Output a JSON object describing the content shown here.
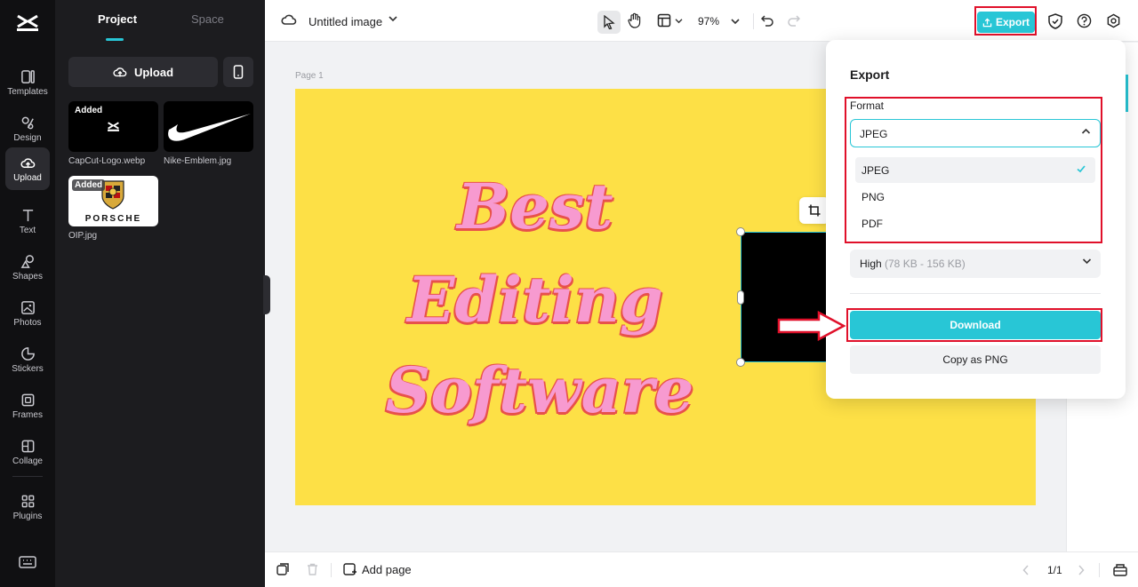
{
  "sidebar": {
    "items": [
      {
        "label": "Templates",
        "icon": "templates-icon"
      },
      {
        "label": "Design",
        "icon": "design-icon"
      },
      {
        "label": "Upload",
        "icon": "upload-cloud-icon",
        "active": true
      },
      {
        "label": "Text",
        "icon": "text-icon"
      },
      {
        "label": "Shapes",
        "icon": "shapes-icon"
      },
      {
        "label": "Photos",
        "icon": "photos-icon"
      },
      {
        "label": "Stickers",
        "icon": "stickers-icon"
      },
      {
        "label": "Frames",
        "icon": "frames-icon"
      },
      {
        "label": "Collage",
        "icon": "collage-icon"
      },
      {
        "label": "Plugins",
        "icon": "plugins-icon"
      }
    ]
  },
  "panel": {
    "tabs": [
      {
        "label": "Project"
      },
      {
        "label": "Space"
      }
    ],
    "upload_label": "Upload",
    "assets": [
      {
        "name": "CapCut-Logo.webp",
        "badge": "Added"
      },
      {
        "name": "Nike-Emblem.jpg"
      },
      {
        "name": "OIP.jpg",
        "badge": "Added",
        "logo_text": "PORSCHE"
      }
    ]
  },
  "topbar": {
    "title": "Untitled image",
    "zoom": "97%",
    "export_label": "Export"
  },
  "canvas": {
    "page_label": "Page 1",
    "lines": [
      "Best",
      "Editing",
      "Software"
    ]
  },
  "bottombar": {
    "add_page": "Add page",
    "pager": "1/1"
  },
  "export_panel": {
    "title": "Export",
    "format_label": "Format",
    "format_value": "JPEG",
    "options": [
      {
        "label": "JPEG",
        "selected": true
      },
      {
        "label": "PNG"
      },
      {
        "label": "PDF"
      }
    ],
    "quality_value": "High",
    "quality_range": "(78 KB - 156 KB)",
    "download_label": "Download",
    "copy_label": "Copy as PNG"
  },
  "colors": {
    "accent": "#28c6d6",
    "highlight": "#e0102a",
    "artboard": "#fde046",
    "text_fill": "#f79ad0",
    "text_outline": "#e8514a"
  }
}
